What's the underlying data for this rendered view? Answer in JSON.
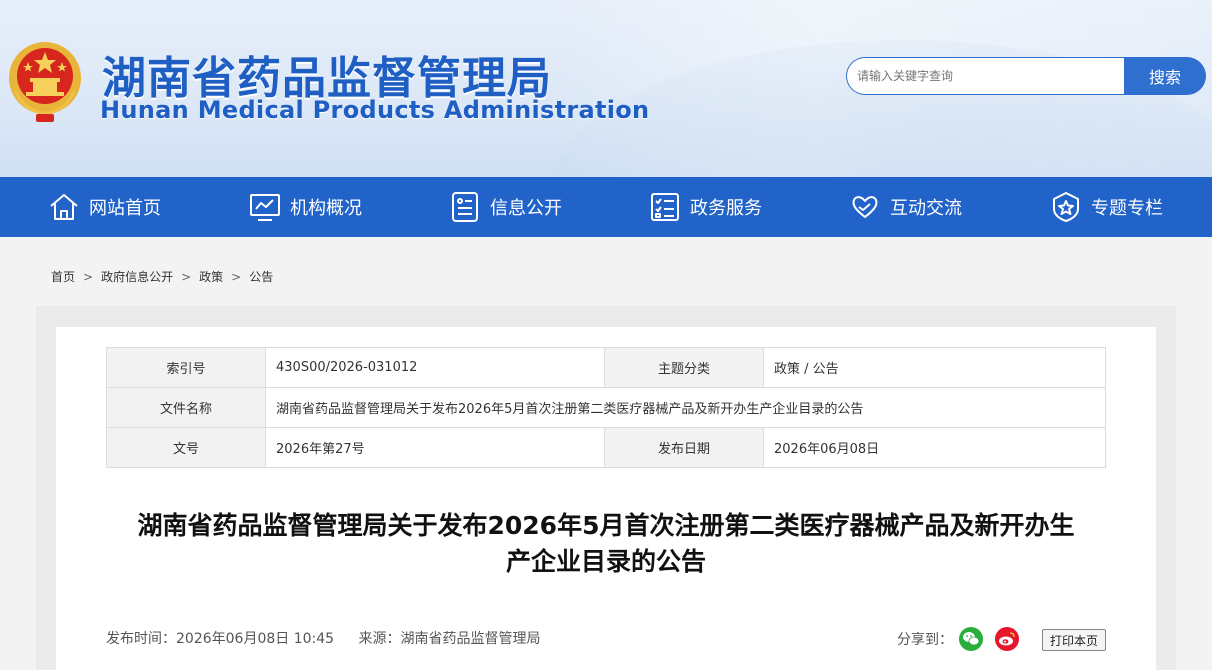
{
  "header": {
    "title_cn": "湖南省药品监督管理局",
    "title_en": "Hunan Medical Products Administration"
  },
  "search": {
    "placeholder": "请输入关键字查询",
    "button_label": "搜索"
  },
  "nav": {
    "items": [
      {
        "label": "网站首页",
        "icon": "home-icon"
      },
      {
        "label": "机构概况",
        "icon": "monitor-chart-icon"
      },
      {
        "label": "信息公开",
        "icon": "document-info-icon"
      },
      {
        "label": "政务服务",
        "icon": "checklist-icon"
      },
      {
        "label": "互动交流",
        "icon": "heart-hands-icon"
      },
      {
        "label": "专题专栏",
        "icon": "star-badge-icon"
      }
    ]
  },
  "breadcrumb": [
    "首页",
    "政府信息公开",
    "政策",
    "公告"
  ],
  "meta": {
    "index_key": "索引号",
    "index_val": "430S00/2026-031012",
    "topic_key": "主题分类",
    "topic_val": "政策 / 公告",
    "filename_key": "文件名称",
    "filename_val": "湖南省药品监督管理局关于发布2026年5月首次注册第二类医疗器械产品及新开办生产企业目录的公告",
    "docno_key": "文号",
    "docno_val": "2026年第27号",
    "date_key": "发布日期",
    "date_val": "2026年06月08日"
  },
  "article": {
    "title_line1": "湖南省药品监督管理局关于发布2026年5月首次注册第二类医疗器械产品及新开办生",
    "title_line2": "产企业目录的公告",
    "publish_time": "发布时间：2026年06月08日 10:45",
    "source": "来源：湖南省药品监督管理局"
  },
  "share": {
    "label": "分享到：",
    "print_label": "打印本页"
  },
  "colors": {
    "brand_blue": "#2163c8",
    "wechat_green": "#2aae3b",
    "weibo_red": "#e6162d"
  }
}
